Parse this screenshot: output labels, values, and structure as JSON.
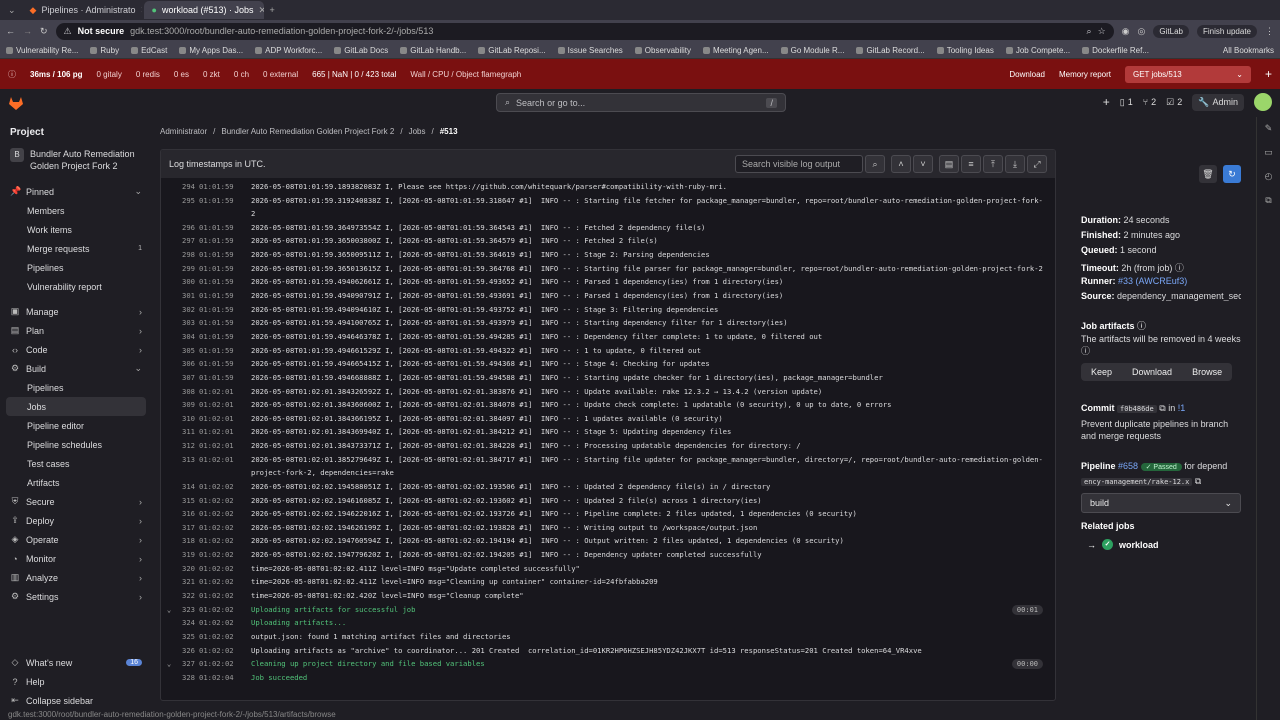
{
  "browser": {
    "tabs": [
      {
        "title": "Pipelines · Administrato",
        "active": false
      },
      {
        "title": "workload (#513) · Jobs",
        "active": true
      }
    ],
    "not_secure": "Not secure",
    "url": "gdk.test:3000/root/bundler-auto-remediation-golden-project-fork-2/-/jobs/513",
    "profile": "GitLab",
    "finish_update": "Finish update",
    "bookmarks": [
      "Vulnerability Re...",
      "Ruby",
      "EdCast",
      "My Apps Das...",
      "ADP Workforc...",
      "GitLab Docs",
      "GitLab Handb...",
      "GitLab Reposi...",
      "Issue Searches",
      "Observability",
      "Meeting Agen...",
      "Go Module R...",
      "GitLab Record...",
      "Tooling Ideas",
      "Job Compete...",
      "Dockerfile Ref..."
    ],
    "all_bookmarks": "All Bookmarks"
  },
  "perf": {
    "items": [
      "36ms / 106 pg",
      "0 gitaly",
      "0 redis",
      "0 es",
      "0 zkt",
      "0 ch",
      "0 external",
      "665 | NaN | 0 / 423 total",
      "Wall / CPU / Object flamegraph"
    ],
    "download": "Download",
    "memory": "Memory report",
    "request": "GET jobs/513"
  },
  "header": {
    "search_placeholder": "Search or go to...",
    "search_key": "/",
    "counts": [
      "1",
      "2",
      "2"
    ],
    "admin": "Admin"
  },
  "sidebar": {
    "title": "Project",
    "project_badge": "B",
    "project_name": "Bundler Auto Remediation Golden Project Fork 2",
    "items": [
      {
        "label": "Pinned",
        "icon": "pin-icon",
        "chev": "⌄"
      },
      {
        "label": "Members",
        "sub": true
      },
      {
        "label": "Work items",
        "sub": true
      },
      {
        "label": "Merge requests",
        "sub": true,
        "count": "1"
      },
      {
        "label": "Pipelines",
        "sub": true
      },
      {
        "label": "Vulnerability report",
        "sub": true
      },
      {
        "label": "Manage",
        "chev": "›",
        "gap": true
      },
      {
        "label": "Plan",
        "chev": "›"
      },
      {
        "label": "Code",
        "chev": "›"
      },
      {
        "label": "Build",
        "chev": "⌄"
      },
      {
        "label": "Pipelines",
        "sub": true
      },
      {
        "label": "Jobs",
        "sub": true,
        "active": true
      },
      {
        "label": "Pipeline editor",
        "sub": true
      },
      {
        "label": "Pipeline schedules",
        "sub": true
      },
      {
        "label": "Test cases",
        "sub": true
      },
      {
        "label": "Artifacts",
        "sub": true
      },
      {
        "label": "Secure",
        "chev": "›"
      },
      {
        "label": "Deploy",
        "chev": "›"
      },
      {
        "label": "Operate",
        "chev": "›"
      },
      {
        "label": "Monitor",
        "chev": "›"
      },
      {
        "label": "Analyze",
        "chev": "›"
      },
      {
        "label": "Settings",
        "chev": "›"
      }
    ],
    "bottom": [
      {
        "label": "What's new",
        "badge": "16"
      },
      {
        "label": "Help"
      },
      {
        "label": "Collapse sidebar"
      }
    ]
  },
  "breadcrumb": [
    "Administrator",
    "Bundler Auto Remediation Golden Project Fork 2",
    "Jobs",
    "#513"
  ],
  "log": {
    "header": "Log timestamps in UTC.",
    "search_placeholder": "Search visible log output",
    "lines": [
      {
        "n": "294",
        "t": "01:01:59",
        "x": "2026-05-08T01:01:59.189382083Z I, Please see https://github.com/whitequark/parser#compatibility-with-ruby-mri."
      },
      {
        "n": "295",
        "t": "01:01:59",
        "x": "2026-05-08T01:01:59.319240838Z I, [2026-05-08T01:01:59.318647 #1]  INFO -- : Starting file fetcher for package_manager=bundler, repo=root/bundler-auto-remediation-golden-project-fork-2"
      },
      {
        "n": "296",
        "t": "01:01:59",
        "x": "2026-05-08T01:01:59.364973554Z I, [2026-05-08T01:01:59.364543 #1]  INFO -- : Fetched 2 dependency file(s)"
      },
      {
        "n": "297",
        "t": "01:01:59",
        "x": "2026-05-08T01:01:59.365003800Z I, [2026-05-08T01:01:59.364579 #1]  INFO -- : Fetched 2 file(s)"
      },
      {
        "n": "298",
        "t": "01:01:59",
        "x": "2026-05-08T01:01:59.365009511Z I, [2026-05-08T01:01:59.364619 #1]  INFO -- : Stage 2: Parsing dependencies"
      },
      {
        "n": "299",
        "t": "01:01:59",
        "x": "2026-05-08T01:01:59.365013615Z I, [2026-05-08T01:01:59.364768 #1]  INFO -- : Starting file parser for package_manager=bundler, repo=root/bundler-auto-remediation-golden-project-fork-2"
      },
      {
        "n": "300",
        "t": "01:01:59",
        "x": "2026-05-08T01:01:59.494062661Z I, [2026-05-08T01:01:59.493652 #1]  INFO -- : Parsed 1 dependency(ies) from 1 directory(ies)"
      },
      {
        "n": "301",
        "t": "01:01:59",
        "x": "2026-05-08T01:01:59.494090791Z I, [2026-05-08T01:01:59.493691 #1]  INFO -- : Parsed 1 dependency(ies) from 1 directory(ies)"
      },
      {
        "n": "302",
        "t": "01:01:59",
        "x": "2026-05-08T01:01:59.494094610Z I, [2026-05-08T01:01:59.493752 #1]  INFO -- : Stage 3: Filtering dependencies"
      },
      {
        "n": "303",
        "t": "01:01:59",
        "x": "2026-05-08T01:01:59.494100765Z I, [2026-05-08T01:01:59.493979 #1]  INFO -- : Starting dependency filter for 1 directory(ies)"
      },
      {
        "n": "304",
        "t": "01:01:59",
        "x": "2026-05-08T01:01:59.494646378Z I, [2026-05-08T01:01:59.494285 #1]  INFO -- : Dependency filter complete: 1 to update, 0 filtered out"
      },
      {
        "n": "305",
        "t": "01:01:59",
        "x": "2026-05-08T01:01:59.494661529Z I, [2026-05-08T01:01:59.494322 #1]  INFO -- : 1 to update, 0 filtered out"
      },
      {
        "n": "306",
        "t": "01:01:59",
        "x": "2026-05-08T01:01:59.494665415Z I, [2026-05-08T01:01:59.494368 #1]  INFO -- : Stage 4: Checking for updates"
      },
      {
        "n": "307",
        "t": "01:01:59",
        "x": "2026-05-08T01:01:59.494668888Z I, [2026-05-08T01:01:59.494588 #1]  INFO -- : Starting update checker for 1 directory(ies), package_manager=bundler"
      },
      {
        "n": "308",
        "t": "01:02:01",
        "x": "2026-05-08T01:02:01.384326592Z I, [2026-05-08T01:02:01.383876 #1]  INFO -- : Update available: rake 12.3.2 → 13.4.2 (version update)"
      },
      {
        "n": "309",
        "t": "01:02:01",
        "x": "2026-05-08T01:02:01.384360600Z I, [2026-05-08T01:02:01.384078 #1]  INFO -- : Update check complete: 1 updatable (0 security), 0 up to date, 0 errors"
      },
      {
        "n": "310",
        "t": "01:02:01",
        "x": "2026-05-08T01:02:01.384366195Z I, [2026-05-08T01:02:01.384097 #1]  INFO -- : 1 updates available (0 security)"
      },
      {
        "n": "311",
        "t": "01:02:01",
        "x": "2026-05-08T01:02:01.384369940Z I, [2026-05-08T01:02:01.384212 #1]  INFO -- : Stage 5: Updating dependency files"
      },
      {
        "n": "312",
        "t": "01:02:01",
        "x": "2026-05-08T01:02:01.384373371Z I, [2026-05-08T01:02:01.384228 #1]  INFO -- : Processing updatable dependencies for directory: /"
      },
      {
        "n": "313",
        "t": "01:02:01",
        "x": "2026-05-08T01:02:01.385279649Z I, [2026-05-08T01:02:01.384717 #1]  INFO -- : Starting file updater for package_manager=bundler, directory=/, repo=root/bundler-auto-remediation-golden-project-fork-2, dependencies=rake"
      },
      {
        "n": "314",
        "t": "01:02:02",
        "x": "2026-05-08T01:02:02.194588051Z I, [2026-05-08T01:02:02.193506 #1]  INFO -- : Updated 2 dependency file(s) in / directory"
      },
      {
        "n": "315",
        "t": "01:02:02",
        "x": "2026-05-08T01:02:02.194616085Z I, [2026-05-08T01:02:02.193602 #1]  INFO -- : Updated 2 file(s) across 1 directory(ies)"
      },
      {
        "n": "316",
        "t": "01:02:02",
        "x": "2026-05-08T01:02:02.194622016Z I, [2026-05-08T01:02:02.193726 #1]  INFO -- : Pipeline complete: 2 files updated, 1 dependencies (0 security)"
      },
      {
        "n": "317",
        "t": "01:02:02",
        "x": "2026-05-08T01:02:02.194626199Z I, [2026-05-08T01:02:02.193828 #1]  INFO -- : Writing output to /workspace/output.json"
      },
      {
        "n": "318",
        "t": "01:02:02",
        "x": "2026-05-08T01:02:02.194760594Z I, [2026-05-08T01:02:02.194194 #1]  INFO -- : Output written: 2 files updated, 1 dependencies (0 security)"
      },
      {
        "n": "319",
        "t": "01:02:02",
        "x": "2026-05-08T01:02:02.194779620Z I, [2026-05-08T01:02:02.194205 #1]  INFO -- : Dependency updater completed successfully"
      },
      {
        "n": "320",
        "t": "01:02:02",
        "x": "time=2026-05-08T01:02:02.411Z level=INFO msg=\"Update completed successfully\""
      },
      {
        "n": "321",
        "t": "01:02:02",
        "x": "time=2026-05-08T01:02:02.411Z level=INFO msg=\"Cleaning up container\" container-id=24fbfabba209"
      },
      {
        "n": "322",
        "t": "01:02:02",
        "x": "time=2026-05-08T01:02:02.420Z level=INFO msg=\"Cleanup complete\""
      },
      {
        "n": "323",
        "t": "01:02:02",
        "x": "Uploading artifacts for successful job",
        "green": true,
        "collapse": true,
        "dur": "00:01"
      },
      {
        "n": "324",
        "t": "01:02:02",
        "x": "Uploading artifacts...",
        "green": true
      },
      {
        "n": "325",
        "t": "01:02:02",
        "x": "output.json: found 1 matching artifact files and directories"
      },
      {
        "n": "326",
        "t": "01:02:02",
        "x": "Uploading artifacts as \"archive\" to coordinator... 201 Created  correlation_id=01KR2HP6HZSEJH85YDZ42JKX7T id=513 responseStatus=201 Created token=64_VR4xve"
      },
      {
        "n": "327",
        "t": "01:02:02",
        "x": "Cleaning up project directory and file based variables",
        "green": true,
        "collapse": true,
        "dur": "00:00"
      },
      {
        "n": "328",
        "t": "01:02:04",
        "x": "Job succeeded",
        "green": true
      }
    ]
  },
  "details": {
    "duration_label": "Duration:",
    "duration": "24 seconds",
    "finished_label": "Finished:",
    "finished": "2 minutes ago",
    "queued_label": "Queued:",
    "queued": "1 second",
    "timeout_label": "Timeout:",
    "timeout": "2h (from job)",
    "runner_label": "Runner:",
    "runner": "#33 (AWCREuf3)",
    "source_label": "Source:",
    "source": "dependency_management_sec",
    "artifacts_title": "Job artifacts",
    "artifacts_note": "The artifacts will be removed in 4 weeks",
    "keep": "Keep",
    "download": "Download",
    "browse": "Browse",
    "commit_label": "Commit",
    "commit_sha": "f0b486de",
    "commit_in": "in",
    "commit_mr": "!1",
    "commit_msg": "Prevent duplicate pipelines in branch and merge requests",
    "pipeline_label": "Pipeline",
    "pipeline_id": "#658",
    "pipeline_status": "Passed",
    "pipeline_for": "for depend",
    "pipeline_ref": "ency-management/rake-12.x",
    "stage": "build",
    "related_title": "Related jobs",
    "related_job": "workload"
  },
  "statusbar": "gdk.test:3000/root/bundler-auto-remediation-golden-project-fork-2/-/jobs/513/artifacts/browse"
}
